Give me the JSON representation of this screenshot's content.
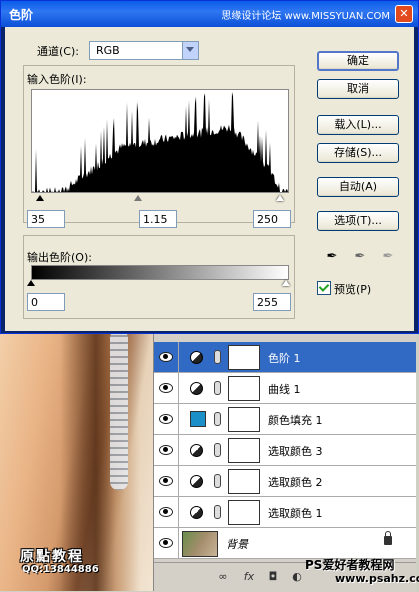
{
  "dialog": {
    "title": "色阶",
    "watermark": "思缘设计论坛 www.MISSYUAN.COM",
    "channel_label": "通道(C):",
    "channel_value": "RGB",
    "input_levels_label": "输入色阶(I):",
    "input_black": "35",
    "input_gamma": "1.15",
    "input_white": "250",
    "output_levels_label": "输出色阶(O):",
    "output_black": "0",
    "output_white": "255",
    "preview_label": "预览(P)",
    "preview_checked": true
  },
  "buttons": {
    "ok": "确定",
    "cancel": "取消",
    "load": "载入(L)...",
    "save": "存储(S)...",
    "auto": "自动(A)",
    "options": "选项(T)..."
  },
  "layers": [
    {
      "name": "色阶 1",
      "type": "adjustment",
      "selected": true
    },
    {
      "name": "曲线 1",
      "type": "adjustment",
      "selected": false
    },
    {
      "name": "颜色填充 1",
      "type": "fill",
      "selected": false
    },
    {
      "name": "选取颜色 3",
      "type": "adjustment",
      "selected": false
    },
    {
      "name": "选取颜色 2",
      "type": "adjustment",
      "selected": false
    },
    {
      "name": "选取颜色 1",
      "type": "adjustment",
      "selected": false
    },
    {
      "name": "背景",
      "type": "background",
      "selected": false
    }
  ],
  "watermarks": {
    "left_title": "原點教程",
    "left_qq": "QQ:13844886",
    "site_name": "PS爱好者教程网",
    "site_url": "www.psahz.com"
  },
  "colors": {
    "title_bar": "#2f76f2",
    "selected_layer": "#316ac5",
    "fill_swatch": "#1a8fc8"
  }
}
